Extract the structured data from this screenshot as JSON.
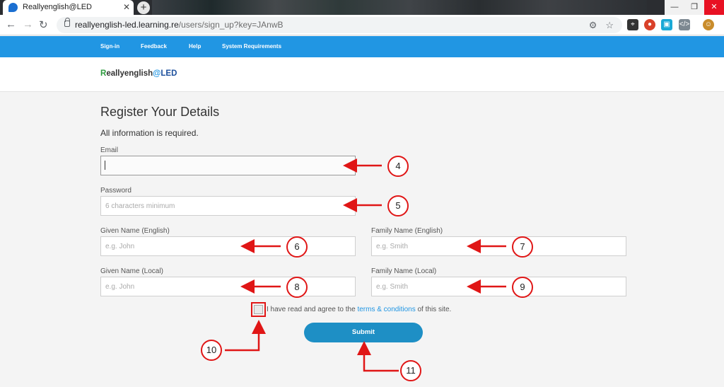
{
  "browser": {
    "tab_title": "Reallyenglish@LED",
    "new_tab_symbol": "+",
    "url_host": "reallyenglish-led.learning.re",
    "url_path": "/users/sign_up?key=JAnwB"
  },
  "sitenav": {
    "items": [
      "Sign-in",
      "Feedback",
      "Help",
      "System Requirements"
    ]
  },
  "logo": {
    "r": "R",
    "main": "eallyenglish",
    "at": "@",
    "led": "LED"
  },
  "form": {
    "heading": "Register Your Details",
    "subheading": "All information is required.",
    "email_label": "Email",
    "email_value": "",
    "password_label": "Password",
    "password_placeholder": "6 characters minimum",
    "given_en_label": "Given Name (English)",
    "given_en_placeholder": "e.g. John",
    "family_en_label": "Family Name (English)",
    "family_en_placeholder": "e.g. Smith",
    "given_local_label": "Given Name (Local)",
    "given_local_placeholder": "e.g. John",
    "family_local_label": "Family Name (Local)",
    "family_local_placeholder": "e.g. Smith",
    "agree_prefix": "I have read and agree to the ",
    "agree_link": "terms & conditions",
    "agree_suffix": " of this site.",
    "submit_label": "Submit"
  },
  "annotations": [
    "4",
    "5",
    "6",
    "7",
    "8",
    "9",
    "10",
    "11"
  ],
  "colors": {
    "nav": "#2196e3",
    "submit": "#1e8fc5",
    "annotation": "#e01616"
  }
}
